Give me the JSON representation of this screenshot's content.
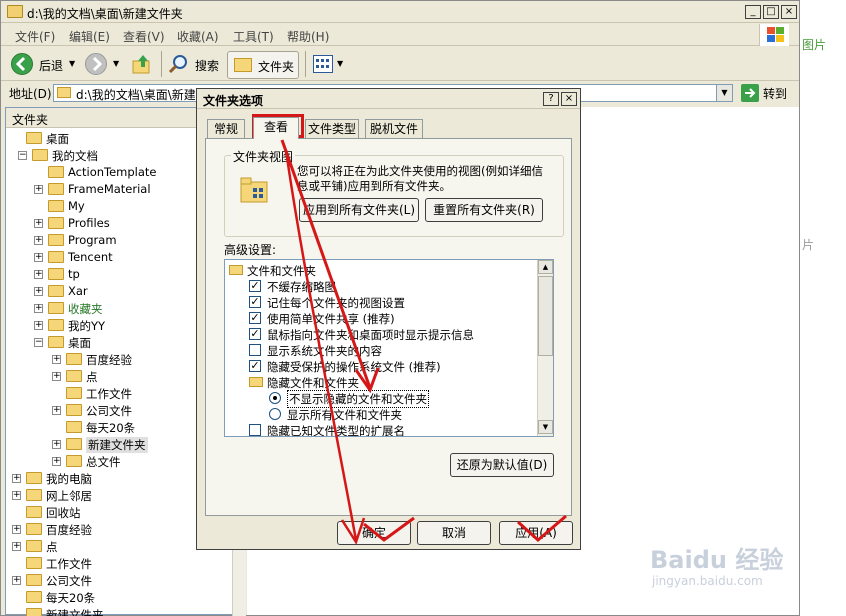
{
  "window": {
    "title": "d:\\我的文档\\桌面\\新建文件夹",
    "min": "_",
    "max": "□",
    "close": "×"
  },
  "menubar": [
    "文件(F)",
    "编辑(E)",
    "查看(V)",
    "收藏(A)",
    "工具(T)",
    "帮助(H)"
  ],
  "toolbar": {
    "back": "后退",
    "search": "搜索",
    "folders": "文件夹"
  },
  "addressbar": {
    "label": "地址(D)",
    "value": "d:\\我的文档\\桌面\\新建文件夹",
    "go": "转到"
  },
  "folders_pane": {
    "header": "文件夹",
    "tree": [
      {
        "label": "桌面",
        "level": 0,
        "exp": ""
      },
      {
        "label": "我的文档",
        "level": 1,
        "exp": "⊟"
      },
      {
        "label": "ActionTemplate",
        "level": 2,
        "exp": ""
      },
      {
        "label": "FrameMaterial",
        "level": 2,
        "exp": "+"
      },
      {
        "label": "My",
        "level": 2,
        "exp": ""
      },
      {
        "label": "Profiles",
        "level": 2,
        "exp": "+"
      },
      {
        "label": "Program",
        "level": 2,
        "exp": "+"
      },
      {
        "label": "Tencent",
        "level": 2,
        "exp": "+"
      },
      {
        "label": "tp",
        "level": 2,
        "exp": "+"
      },
      {
        "label": "Xar",
        "level": 2,
        "exp": "+"
      },
      {
        "label": "收藏夹",
        "level": 2,
        "exp": "+"
      },
      {
        "label": "我的YY",
        "level": 2,
        "exp": "+"
      },
      {
        "label": "桌面",
        "level": 2,
        "exp": "−"
      },
      {
        "label": "百度经验",
        "level": 3,
        "exp": "+"
      },
      {
        "label": "点",
        "level": 3,
        "exp": "+"
      },
      {
        "label": "工作文件",
        "level": 3,
        "exp": ""
      },
      {
        "label": "公司文件",
        "level": 3,
        "exp": "+"
      },
      {
        "label": "每天20条",
        "level": 3,
        "exp": ""
      },
      {
        "label": "新建文件夹",
        "level": 3,
        "exp": "+"
      },
      {
        "label": "总文件",
        "level": 3,
        "exp": "+"
      },
      {
        "label": "我的电脑",
        "level": 0,
        "exp": "+"
      },
      {
        "label": "网上邻居",
        "level": 0,
        "exp": "+"
      },
      {
        "label": "回收站",
        "level": 0,
        "exp": ""
      },
      {
        "label": "百度经验",
        "level": 0,
        "exp": "+"
      },
      {
        "label": "点",
        "level": 0,
        "exp": "+"
      },
      {
        "label": "工作文件",
        "level": 0,
        "exp": ""
      },
      {
        "label": "公司文件",
        "level": 0,
        "exp": "+"
      },
      {
        "label": "每天20条",
        "level": 0,
        "exp": ""
      },
      {
        "label": "新建文件夹",
        "level": 0,
        "exp": ""
      }
    ]
  },
  "dialog": {
    "title": "文件夹选项",
    "help": "?",
    "close": "×",
    "tabs": [
      "常规",
      "查看",
      "文件类型",
      "脱机文件"
    ],
    "active_tab": "查看",
    "folder_views": {
      "title": "文件夹视图",
      "desc": "您可以将正在为此文件夹使用的视图(例如详细信息或平铺)应用到所有文件夹。",
      "apply_all": "应用到所有文件夹(L)",
      "reset_all": "重置所有文件夹(R)"
    },
    "advanced": {
      "label": "高级设置:",
      "items": [
        {
          "type": "folder",
          "label": "文件和文件夹",
          "indent": 0
        },
        {
          "type": "check",
          "label": "不缓存缩略图",
          "checked": true,
          "indent": 1
        },
        {
          "type": "check",
          "label": "记住每个文件夹的视图设置",
          "checked": true,
          "indent": 1
        },
        {
          "type": "check",
          "label": "使用简单文件共享 (推荐)",
          "checked": true,
          "indent": 1
        },
        {
          "type": "check",
          "label": "鼠标指向文件夹和桌面项时显示提示信息",
          "checked": true,
          "indent": 1
        },
        {
          "type": "check",
          "label": "显示系统文件夹的内容",
          "checked": false,
          "indent": 1
        },
        {
          "type": "check",
          "label": "隐藏受保护的操作系统文件 (推荐)",
          "checked": true,
          "indent": 1
        },
        {
          "type": "folder",
          "label": "隐藏文件和文件夹",
          "indent": 1
        },
        {
          "type": "radio",
          "label": "不显示隐藏的文件和文件夹",
          "checked": true,
          "indent": 2,
          "selected": true
        },
        {
          "type": "radio",
          "label": "显示所有文件和文件夹",
          "checked": false,
          "indent": 2
        },
        {
          "type": "check",
          "label": "隐藏已知文件类型的扩展名",
          "checked": false,
          "indent": 1
        }
      ],
      "restore": "还原为默认值(D)"
    },
    "buttons": {
      "ok": "确定",
      "cancel": "取消",
      "apply": "应用(A)"
    }
  },
  "background": {
    "right_text_1": "图片",
    "right_text_2": "片"
  },
  "watermark": {
    "brand": "Baidu 经验",
    "url": "jingyan.baidu.com"
  }
}
